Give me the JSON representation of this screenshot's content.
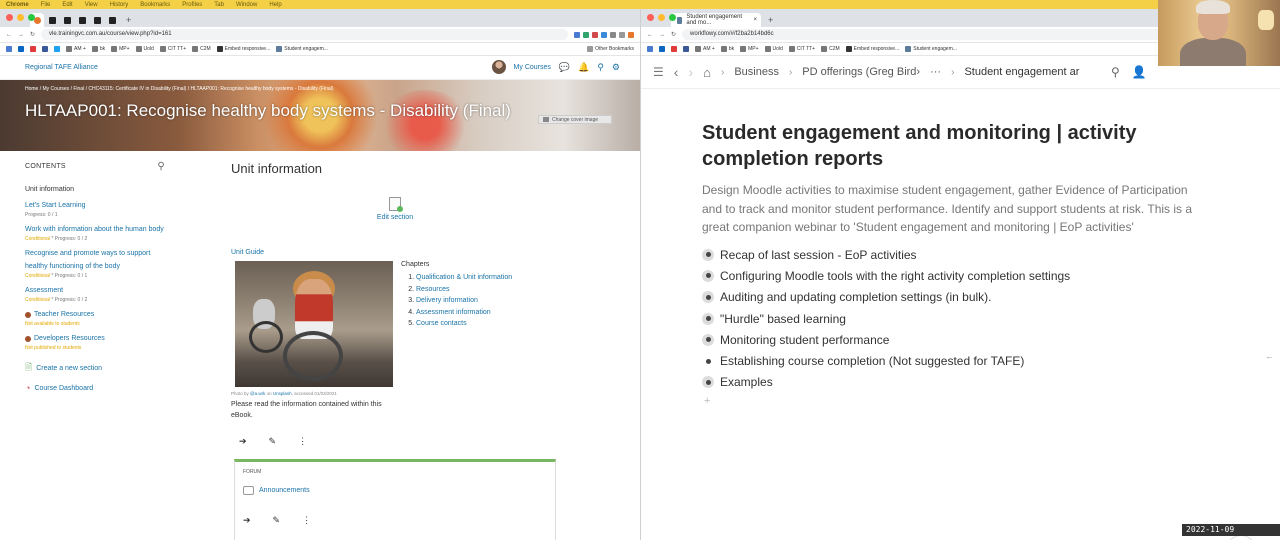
{
  "os_menu": [
    "Chrome",
    "File",
    "Edit",
    "View",
    "History",
    "Bookmarks",
    "Profiles",
    "Tab",
    "Window",
    "Help"
  ],
  "left_browser": {
    "url": "vle.trainingvc.com.au/course/view.php?id=161",
    "bookmarks": [
      "AM +",
      "bk",
      "MP+",
      "Uold",
      "CIT TT+",
      "C2M",
      "Embed responsive...",
      "Student engagem...",
      "Other Bookmarks"
    ]
  },
  "moodle": {
    "brand": "Regional TAFE Alliance",
    "my_courses": "My Courses",
    "breadcrumb": "Home  /  My Courses  /  Final  /  CHC43115: Certificate IV in Disability (Final)  /  HLTAAP001: Recognise healthy body systems - Disability (Final)",
    "course_title": "HLTAAP001: Recognise healthy body systems - Disability (Final)",
    "change_cover": "Change cover image",
    "contents_label": "CONTENTS",
    "unit_information": "Unit information",
    "sections": [
      {
        "name": "Let's Start Learning",
        "progress": "Progress: 0 / 1"
      },
      {
        "name": "Work with information about the human body",
        "cond": "Conditional",
        "progress": " * Progress: 0 / 2"
      },
      {
        "name": "Recognise and promote ways to support healthy functioning of the body",
        "cond": "Conditional",
        "progress": " * Progress: 0 / 1"
      },
      {
        "name": "Assessment",
        "cond": "Conditional",
        "progress": " * Progress: 0 / 2"
      },
      {
        "name": "Teacher Resources",
        "status": "Not available to students"
      },
      {
        "name": "Developers Resources",
        "status": "Not published to students"
      }
    ],
    "create_section": "Create a new section",
    "dashboard": "Course Dashboard",
    "main_heading": "Unit information",
    "edit_section": "Edit section",
    "unit_guide": "Unit Guide",
    "photo_credit_prefix": "Photo by ",
    "photo_credit_name": "@a.wrk",
    "photo_credit_mid": " on ",
    "photo_credit_site": "Unsplash",
    "photo_credit_suffix": ", accessed 01/03/2021",
    "description": "Please read the information contained within this eBook.",
    "chapters_title": "Chapters",
    "chapters": [
      "Qualification & Unit information",
      "Resources",
      "Delivery information",
      "Assessment information",
      "Course contacts"
    ],
    "forum_label": "FORUM",
    "announcements": "Announcements"
  },
  "right_browser": {
    "tab_title": "Student engagement and mo...",
    "url": "workflowy.com/#/f2ba2b14bd6c",
    "bookmarks": [
      "AM +",
      "bk",
      "MP+",
      "Uold",
      "CIT TT+",
      "C2M",
      "Embed responsive...",
      "Student engagem..."
    ]
  },
  "workflowy": {
    "breadcrumb": [
      "Business",
      "PD offerings (Greg Bird›",
      "···",
      "Student engagement ar"
    ],
    "title": "Student engagement and monitoring | activity completion reports",
    "note": "Design Moodle activities to maximise student engagement, gather Evidence of Participation and to track and monitor student performance.  Identify and support students at risk.  This is a great companion webinar to 'Student engagement and monitoring | EoP activities'",
    "items": [
      {
        "text": "Recap of last session - EoP activities",
        "collapsed": true
      },
      {
        "text": "Configuring Moodle tools with the right activity completion settings",
        "collapsed": true
      },
      {
        "text": "Auditing and updating completion settings (in bulk).",
        "collapsed": true
      },
      {
        "text": "\"Hurdle\" based learning",
        "collapsed": true
      },
      {
        "text": "Monitoring student performance",
        "collapsed": true
      },
      {
        "text": "Establishing course completion (Not suggested for TAFE)",
        "collapsed": false
      },
      {
        "text": "Examples",
        "collapsed": true
      }
    ],
    "help": "?"
  },
  "timestamp": "2022-11-09  14:02:34",
  "colors": {
    "moodle_link": "#1a73a8",
    "conditional": "#e0a800",
    "sysbar": "#f3d046"
  }
}
